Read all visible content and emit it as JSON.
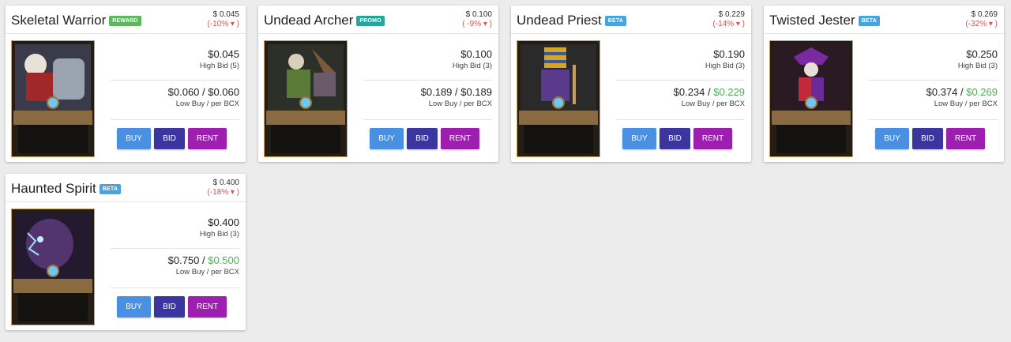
{
  "colors": {
    "buy": "#4a90e2",
    "bid": "#3b35a0",
    "rent": "#9c1fb0",
    "negative": "#d9534f",
    "positive": "#4caf50",
    "reward_badge": "#5cb85c",
    "promo_badge": "#26a69a",
    "beta_badge": "#4aa3df"
  },
  "cards": [
    {
      "name": "Skeletal Warrior",
      "badge": "REWARD",
      "head_price": "$ 0.045",
      "head_change": "(-10% ▾ )",
      "high_bid_value": "$0.045",
      "high_bid_label": "High Bid (5)",
      "low_buy": "$0.060 / $0.060",
      "low_buy_label": "Low Buy / per BCX",
      "buy": "BUY",
      "bid": "BID",
      "rent": "RENT",
      "art_icon": "skeleton-warrior-card-art"
    },
    {
      "name": "Undead Archer",
      "badge": "PROMO",
      "head_price": "$ 0.100",
      "head_change": "( -9% ▾ )",
      "high_bid_value": "$0.100",
      "high_bid_label": "High Bid (3)",
      "low_buy": "$0.189 / $0.189",
      "low_buy_label": "Low Buy / per BCX",
      "buy": "BUY",
      "bid": "BID",
      "rent": "RENT",
      "art_icon": "undead-archer-card-art"
    },
    {
      "name": "Undead Priest",
      "badge": "BETA",
      "head_price": "$ 0.229",
      "head_change": "(-14% ▾ )",
      "high_bid_value": "$0.190",
      "high_bid_label": "High Bid (3)",
      "low_buy_a": "$0.234 / ",
      "low_buy_b": "$0.229",
      "low_buy_label": "Low Buy / per BCX",
      "buy": "BUY",
      "bid": "BID",
      "rent": "RENT",
      "art_icon": "undead-priest-card-art"
    },
    {
      "name": "Twisted Jester",
      "badge": "BETA",
      "head_price": "$ 0.269",
      "head_change": "(-32% ▾ )",
      "high_bid_value": "$0.250",
      "high_bid_label": "High Bid (3)",
      "low_buy_a": "$0.374 / ",
      "low_buy_b": "$0.269",
      "low_buy_label": "Low Buy / per BCX",
      "buy": "BUY",
      "bid": "BID",
      "rent": "RENT",
      "art_icon": "twisted-jester-card-art"
    },
    {
      "name": "Haunted Spirit",
      "badge": "BETA",
      "head_price": "$ 0.400",
      "head_change": "(-18% ▾ )",
      "high_bid_value": "$0.400",
      "high_bid_label": "High Bid (3)",
      "low_buy_a": "$0.750 / ",
      "low_buy_b": "$0.500",
      "low_buy_label": "Low Buy / per BCX",
      "buy": "BUY",
      "bid": "BID",
      "rent": "RENT",
      "art_icon": "haunted-spirit-card-art"
    }
  ]
}
